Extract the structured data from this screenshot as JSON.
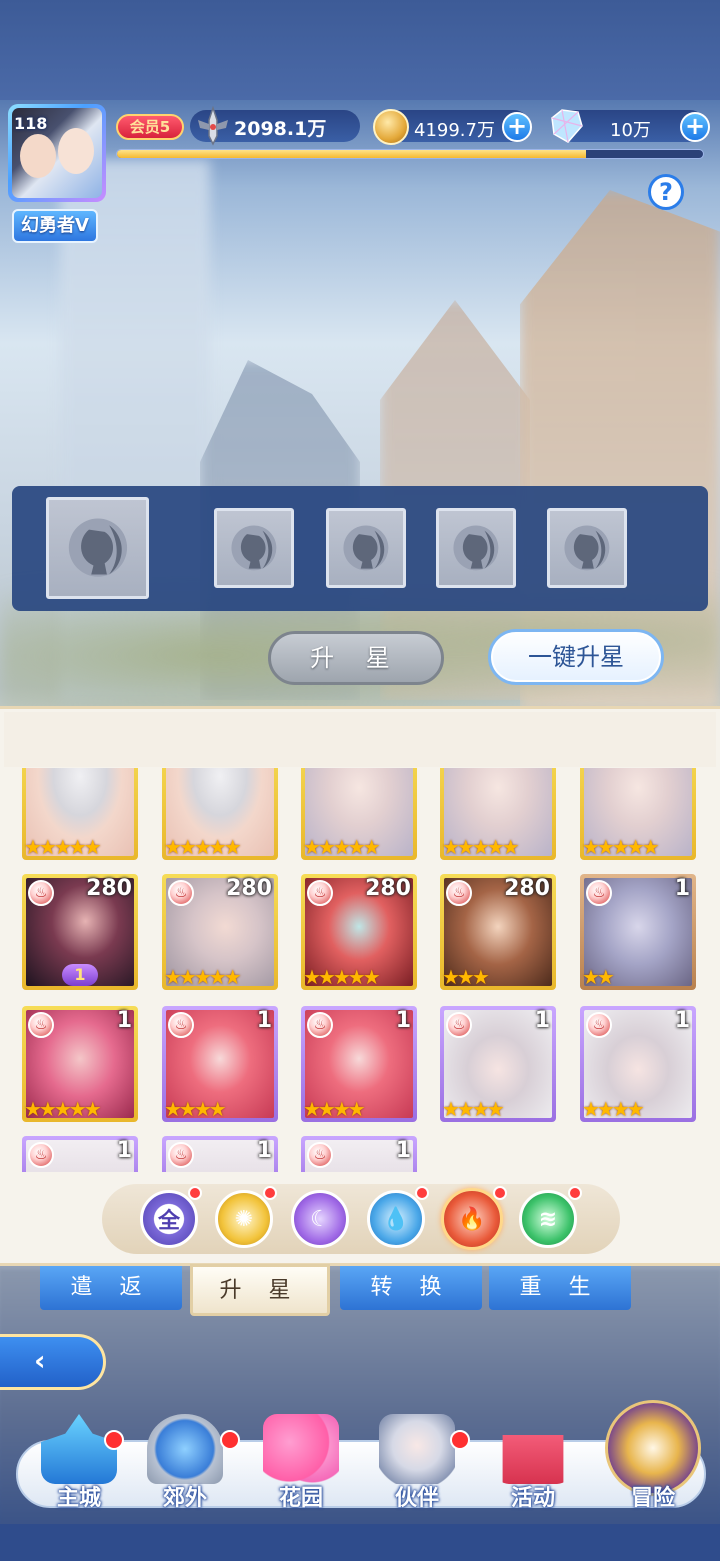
{
  "header": {
    "player_level": "118",
    "player_name": "幻勇者V",
    "vip_label": "会员5",
    "power": "2098.1万",
    "gold": "4199.7万",
    "gems": "10万",
    "plus_symbol": "+",
    "help_symbol": "?",
    "exp_progress": 0.8
  },
  "slots": {
    "icon": "hero-silhouette-icon",
    "count": 5
  },
  "actions": {
    "upstar_label": "升 星",
    "oneclick_label": "一键升星"
  },
  "heroes": [
    {
      "portrait": "p-white",
      "frame": "gold",
      "level": "",
      "stars": "★★★★★"
    },
    {
      "portrait": "p-white",
      "frame": "gold",
      "level": "",
      "stars": "★★★★★"
    },
    {
      "portrait": "p-silver",
      "frame": "gold",
      "level": "",
      "stars": "★★★★★"
    },
    {
      "portrait": "p-silver",
      "frame": "gold",
      "level": "",
      "stars": "★★★★★"
    },
    {
      "portrait": "p-silver",
      "frame": "gold",
      "level": "",
      "stars": "★★★★★"
    },
    {
      "portrait": "p-dark",
      "frame": "gold",
      "level": "280",
      "stars": ""
    },
    {
      "portrait": "p-greyhair",
      "frame": "gold",
      "level": "280",
      "stars": "★★★★★"
    },
    {
      "portrait": "p-red",
      "frame": "gold",
      "level": "280",
      "stars": "★★★★★"
    },
    {
      "portrait": "p-brown",
      "frame": "gold",
      "level": "280",
      "stars": "★★★"
    },
    {
      "portrait": "p-zombie",
      "frame": "bronze",
      "level": "1",
      "stars": "★★"
    },
    {
      "portrait": "p-pink",
      "frame": "gold",
      "level": "1",
      "stars": "★★★★★"
    },
    {
      "portrait": "p-coral",
      "frame": "purple",
      "level": "1",
      "stars": "★★★★"
    },
    {
      "portrait": "p-coral",
      "frame": "purple",
      "level": "1",
      "stars": "★★★★"
    },
    {
      "portrait": "p-cap",
      "frame": "purple",
      "level": "1",
      "stars": "★★★★"
    },
    {
      "portrait": "p-cap",
      "frame": "purple",
      "level": "1",
      "stars": "★★★★"
    },
    {
      "portrait": "p-pale",
      "frame": "purple",
      "level": "1",
      "stars": ""
    },
    {
      "portrait": "p-pale",
      "frame": "purple",
      "level": "1",
      "stars": ""
    },
    {
      "portrait": "p-pale",
      "frame": "purple",
      "level": "1",
      "stars": ""
    }
  ],
  "special_badge": "1",
  "filters": {
    "all_label": "全",
    "icons": [
      "all-element-icon",
      "light-element-icon",
      "dark-element-icon",
      "water-element-icon",
      "fire-element-icon",
      "wind-element-icon"
    ],
    "selected": "fire"
  },
  "tabs": {
    "return": "遣 返",
    "upstar": "升 星",
    "convert": "转 换",
    "rebirth": "重 生",
    "active": "upstar"
  },
  "back_symbol": "‹",
  "nav": {
    "city": "主城",
    "outskirts": "郊外",
    "garden": "花园",
    "partner": "伙伴",
    "event": "活动",
    "adventure": "冒险"
  },
  "colors": {
    "accent_blue": "#2e73d4",
    "gold": "#f5b930",
    "notification": "#ff3030"
  }
}
